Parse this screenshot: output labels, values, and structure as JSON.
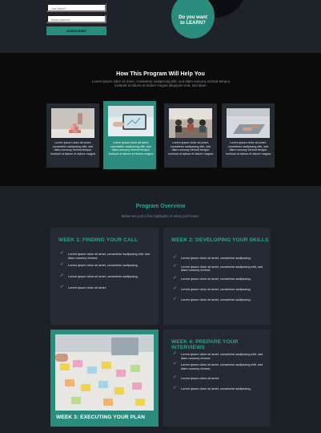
{
  "signup": {
    "last_name_placeholder": "Last Name*",
    "email_placeholder": "Email Address*",
    "subscribe_label": "SUBSCRIBE",
    "cta_circle": "Do you want to LEARN?"
  },
  "help": {
    "title": "How This Program Will Help You",
    "subtitle": "Lorem ipsum dolor sit amet, consetetur sadipscing elitr, sed diam nonumy eirmod tempor invidunt ut labore et dolore magna aliquyam erat, sed diam.",
    "cards": [
      {
        "text": "Lorem ipsum dolor sit amet, consetetur sadipscing elitr, sed diam nonumy eirmod tempor invidunt ut labore et dolore magna"
      },
      {
        "text": "Lorem ipsum dolor sit amet, consetetur sadipscing elitr, sed diam nonumy eirmod tempor invidunt ut labore et dolore magna"
      },
      {
        "text": "Lorem ipsum dolor sit amet, consetetur sadipscing elitr, sed diam nonumy eirmod tempor invidunt ut labore et dolore magna"
      },
      {
        "text": "Lorem ipsum dolor sit amet, consetetur sadipscing elitr, sed diam nonumy eirmod tempor invidunt ut labore et dolore magna"
      }
    ]
  },
  "program": {
    "title": "Program Overview",
    "subtitle": "Below are just a few highlights of what you'll learn.",
    "week1": {
      "title": "WEEK 1: FINDING YOUR CALL",
      "items": [
        "Lorem ipsum dolor sit amet, consetetur sadipscing elitr, sed diam nonumy eirmod.",
        "Lorem ipsum dolor sit amet, consetetur sadipscing.",
        "Lorem ipsum dolor sit amet, consetetur sadipscing.",
        "Lorem ipsum dolor sit amet."
      ]
    },
    "week2": {
      "title": "WEEK 2: DEVELOPING YOUR SKILLS",
      "items": [
        "Lorem ipsum dolor sit amet, consetetur sadipscing.",
        "Lorem ipsum dolor sit amet, consetetur sadipscing elitr, sed diam nonumy eirmod.",
        "Lorem ipsum dolor sit amet, consetetur sadipscing.",
        "Lorem ipsum dolor sit amet, consetetur sadipscing.",
        "Lorem ipsum dolor sit amet, consetetur sadipscing."
      ]
    },
    "week3": {
      "title": "WEEK 3: EXECUTING YOUR PLAN"
    },
    "week4": {
      "title": "WEEK 4: PREPARE YOUR INTERVIEWS",
      "items": [
        "Lorem ipsum dolor sit amet, consetetur sadipscing elitr, sed diam nonumy eirmod.",
        "Lorem ipsum dolor sit amet, consetetur sadipscing elitr, sed diam nonumy eirmod.",
        "Lorem ipsum dolor sit amet.",
        "Lorem ipsum dolor sit amet, consetetur sadipscing."
      ]
    }
  },
  "colors": {
    "accent": "#2a8c7c",
    "accent_text": "#2ea58f",
    "panel": "#252a33",
    "page": "#1c2027"
  }
}
